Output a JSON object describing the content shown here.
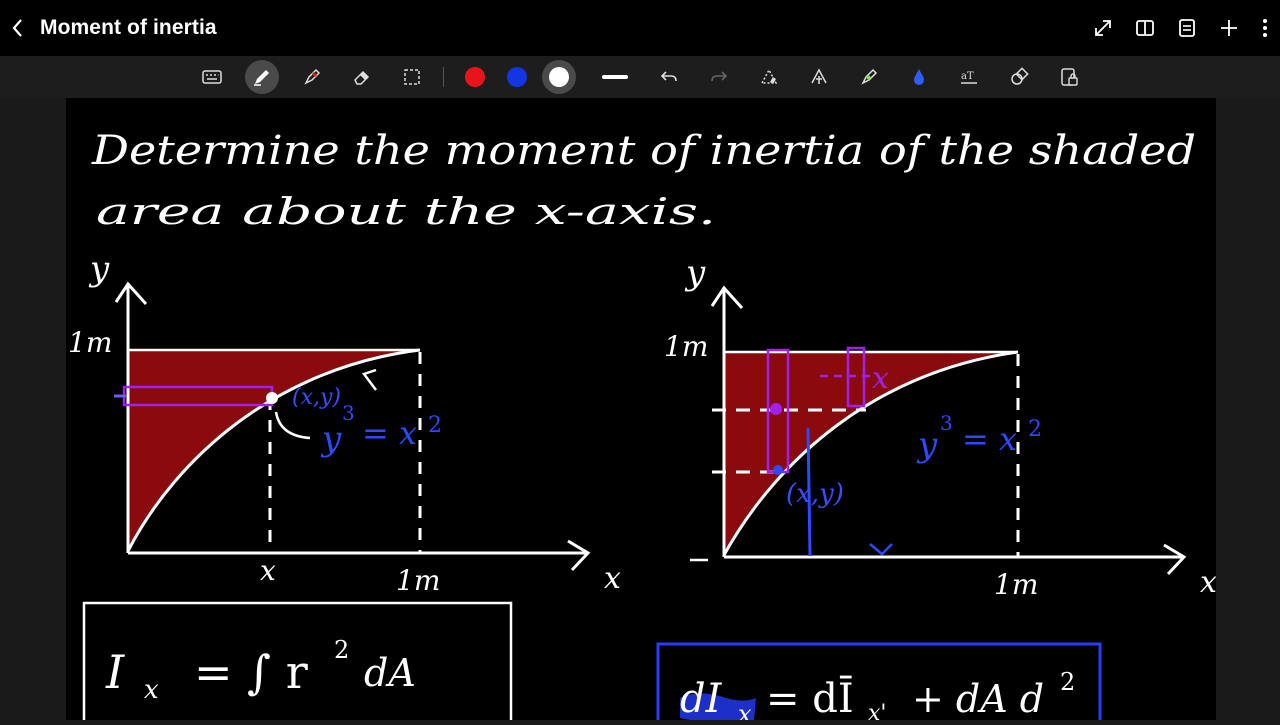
{
  "header": {
    "title": "Moment of inertia"
  },
  "toolbar": {
    "pen_colors": [
      "#e8141c",
      "#1436e0",
      "#ffffff"
    ],
    "active_tool": "pen"
  },
  "note": {
    "problem_line1": "Determine the moment of inertia of the shaded",
    "problem_line2": "area about the x-axis.",
    "left_fig": {
      "y_axis": "y",
      "x_axis": "x",
      "y_tick": "1m",
      "x_tick_1": "x",
      "x_tick_2": "1m",
      "point": "(x,y)",
      "eq_lhs": "y",
      "eq_exp": "3",
      "eq_rhs": "= x",
      "eq_rhs_exp": "2"
    },
    "right_fig": {
      "y_axis": "y",
      "x_axis": "x",
      "y_tick": "1m",
      "x_tick": "1m",
      "point": "(x,y)",
      "eq_lhs": "y",
      "eq_exp": "3",
      "eq_rhs": "= x",
      "eq_rhs_exp": "2",
      "mark": "x"
    },
    "formula_1": {
      "lhs": "I",
      "sub": "x",
      "rhs": "= ∫ r",
      "exp": "2",
      "tail": "dA"
    },
    "formula_2": {
      "lhs": "dI",
      "sub": "x",
      "mid": "= dĪ",
      "mid_sub": "x'",
      "tail": "+ dA d",
      "exp": "2"
    }
  }
}
